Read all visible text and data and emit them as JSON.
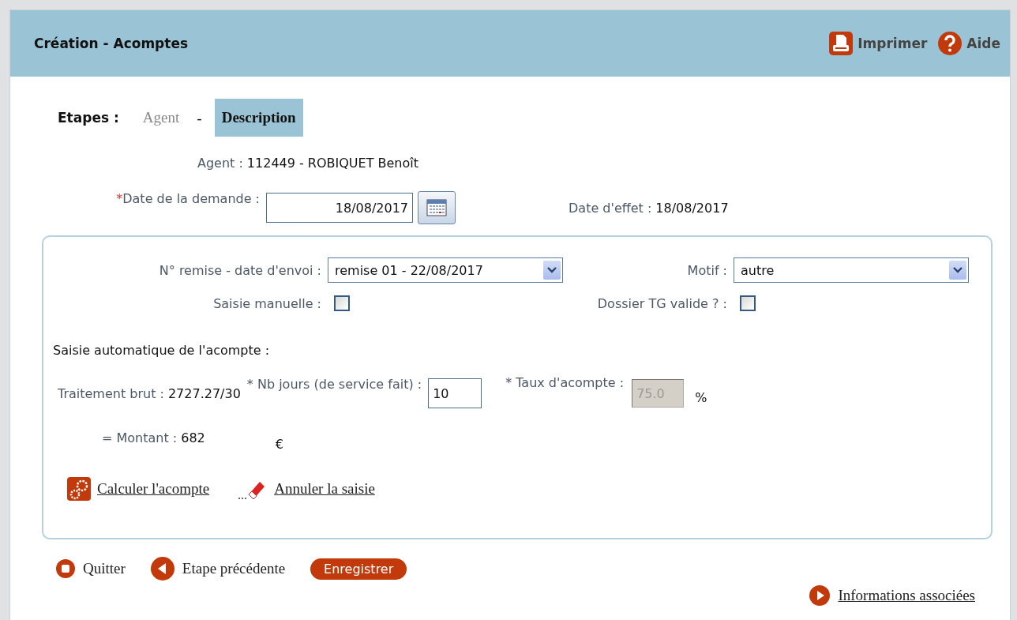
{
  "header": {
    "title": "Création - Acomptes",
    "actions": [
      {
        "label": "Imprimer",
        "kind": "print"
      },
      {
        "label": "Aide",
        "kind": "help"
      }
    ]
  },
  "steps": {
    "label": "Etapes :",
    "separator": "-",
    "items": [
      {
        "label": "Agent",
        "selected": false
      },
      {
        "label": "Description",
        "selected": true
      }
    ]
  },
  "agent": {
    "label": "Agent :",
    "value": "112449 - ROBIQUET Benoît"
  },
  "request_date": {
    "required_mark": "*",
    "label": "Date de la demande :",
    "value": "18/08/2017"
  },
  "effect_date": {
    "label": "Date d'effet :",
    "value": "18/08/2017"
  },
  "remise": {
    "label": "N° remise - date d'envoi :",
    "value": "remise 01 - 22/08/2017"
  },
  "motif": {
    "label": "Motif :",
    "value": "autre"
  },
  "manual_entry": {
    "label": "Saisie manuelle :",
    "checked": false
  },
  "tg_valid": {
    "label": "Dossier TG valide ? :",
    "checked": false
  },
  "auto_title": "Saisie automatique de l'acompte :",
  "gross_salary": {
    "label": "Traitement brut :",
    "value": "2727.27/30"
  },
  "days": {
    "label": "* Nb jours (de service fait) :",
    "value": "10"
  },
  "rate": {
    "label": "* Taux d'acompte :",
    "value": "75.0",
    "disabled": true,
    "unit": "%"
  },
  "amount": {
    "label": "= Montant :",
    "value": "682",
    "currency": "€"
  },
  "links": [
    {
      "label": "Calculer l'acompte",
      "kind": "calculate"
    },
    {
      "label": "Annuler la saisie",
      "kind": "erase"
    }
  ],
  "buttons": [
    {
      "label": "Quitter",
      "kind": "quit"
    },
    {
      "label": "Etape précédente",
      "kind": "back"
    },
    {
      "label": "Enregistrer",
      "kind": "save"
    }
  ],
  "info_link": "Informations associées"
}
